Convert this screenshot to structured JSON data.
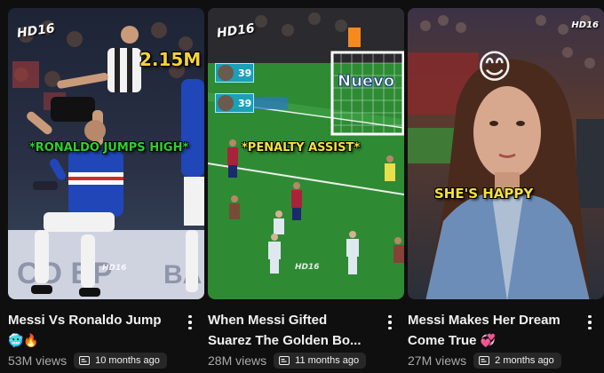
{
  "videos": [
    {
      "title": "Messi Vs Ronaldo Jump",
      "title_emoji": "🥶🔥",
      "views": "53M views",
      "age": "10 months ago",
      "overlay_caption": "*RONALDO JUMPS HIGH*",
      "overlay_views": "2.15M",
      "channel_logo": "HD16",
      "watermark": "HD16",
      "thumb_colors": {
        "caption": "#2ed12e",
        "stat": "#f5d23a"
      }
    },
    {
      "title_line1": "When Messi Gifted",
      "title_line2": "Suarez The Golden Bo...",
      "views": "28M views",
      "age": "11 months ago",
      "overlay_caption": "*PENALTY ASSIST*",
      "channel_logo": "HD16",
      "watermark": "HD16",
      "board_text": "Nuevo",
      "scores": [
        "39",
        "39"
      ],
      "thumb_colors": {
        "caption": "#f5e23a"
      }
    },
    {
      "title_line1": "Messi Makes Her Dream",
      "title_line2": "Come True",
      "title_emoji": "💞",
      "views": "27M views",
      "age": "2 months ago",
      "overlay_caption": "SHE'S HAPPY",
      "overlay_emoji": "😊",
      "channel_logo": "HD16",
      "thumb_colors": {
        "caption": "#f7e13a"
      }
    }
  ],
  "icons": {
    "more": "more-vert-icon",
    "chip": "shorts-chip-icon"
  }
}
